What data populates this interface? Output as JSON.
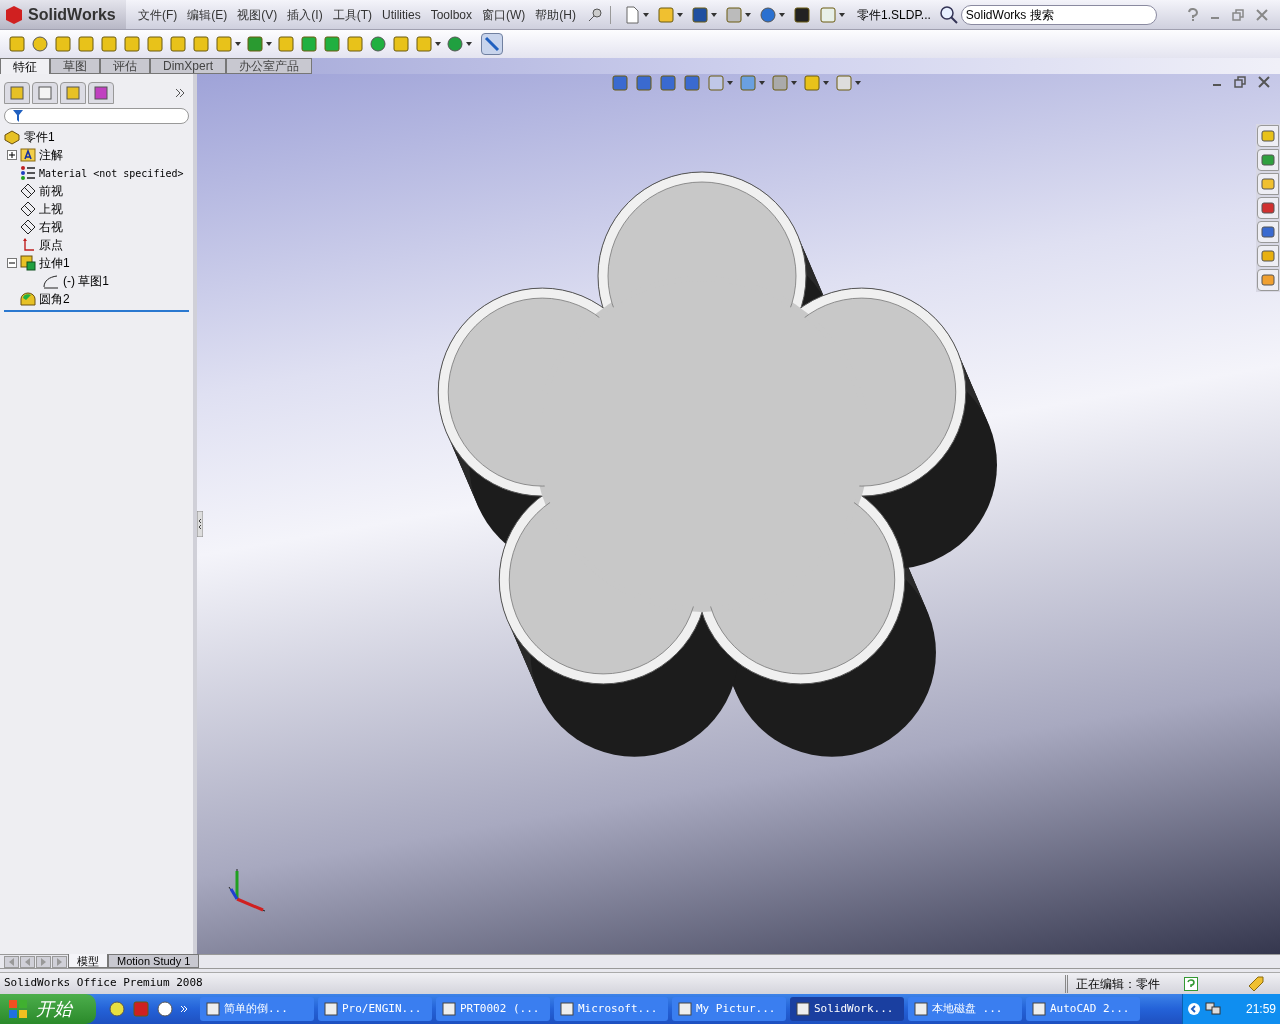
{
  "app_bar": {
    "logo": "SolidWorks",
    "menus": [
      "文件(F)",
      "编辑(E)",
      "视图(V)",
      "插入(I)",
      "工具(T)",
      "Utilities",
      "Toolbox",
      "窗口(W)",
      "帮助(H)"
    ],
    "document_title": "零件1.SLDP...",
    "search": {
      "placeholder": "SolidWorks 搜索"
    }
  },
  "command_tabs": [
    {
      "label": "特征",
      "selected": true
    },
    {
      "label": "草图",
      "selected": false
    },
    {
      "label": "评估",
      "selected": false
    },
    {
      "label": "DimXpert",
      "selected": false
    },
    {
      "label": "办公室产品",
      "selected": false
    }
  ],
  "feature_tree": {
    "root": "零件1",
    "items": [
      {
        "kind": "annotation",
        "label": "注解",
        "expanded": false
      },
      {
        "kind": "material",
        "label": "Material <not specified>"
      },
      {
        "kind": "plane",
        "label": "前视"
      },
      {
        "kind": "plane",
        "label": "上视"
      },
      {
        "kind": "plane",
        "label": "右视"
      },
      {
        "kind": "origin",
        "label": "原点"
      },
      {
        "kind": "extrude",
        "label": "拉伸1",
        "expanded": true,
        "children": [
          {
            "kind": "sketch",
            "label": "(-) 草图1"
          }
        ]
      },
      {
        "kind": "fillet",
        "label": "圆角2"
      }
    ]
  },
  "bottom_tabs": [
    {
      "label": "模型",
      "selected": true
    },
    {
      "label": "Motion Study 1",
      "selected": false
    }
  ],
  "status_bar": {
    "product": "SolidWorks Office Premium 2008",
    "mode": "正在编辑：零件"
  },
  "taskbar": {
    "start": "开始",
    "tasks": [
      {
        "label": "简单的倒...",
        "selected": false
      },
      {
        "label": "Pro/ENGIN...",
        "selected": false
      },
      {
        "label": "PRT0002 (...",
        "selected": false
      },
      {
        "label": "Microsoft...",
        "selected": false
      },
      {
        "label": "My Pictur...",
        "selected": false
      },
      {
        "label": "SolidWork...",
        "selected": true
      },
      {
        "label": "本地磁盘 ...",
        "selected": false
      },
      {
        "label": "AutoCAD 2...",
        "selected": false
      }
    ],
    "clock": "21:59"
  }
}
